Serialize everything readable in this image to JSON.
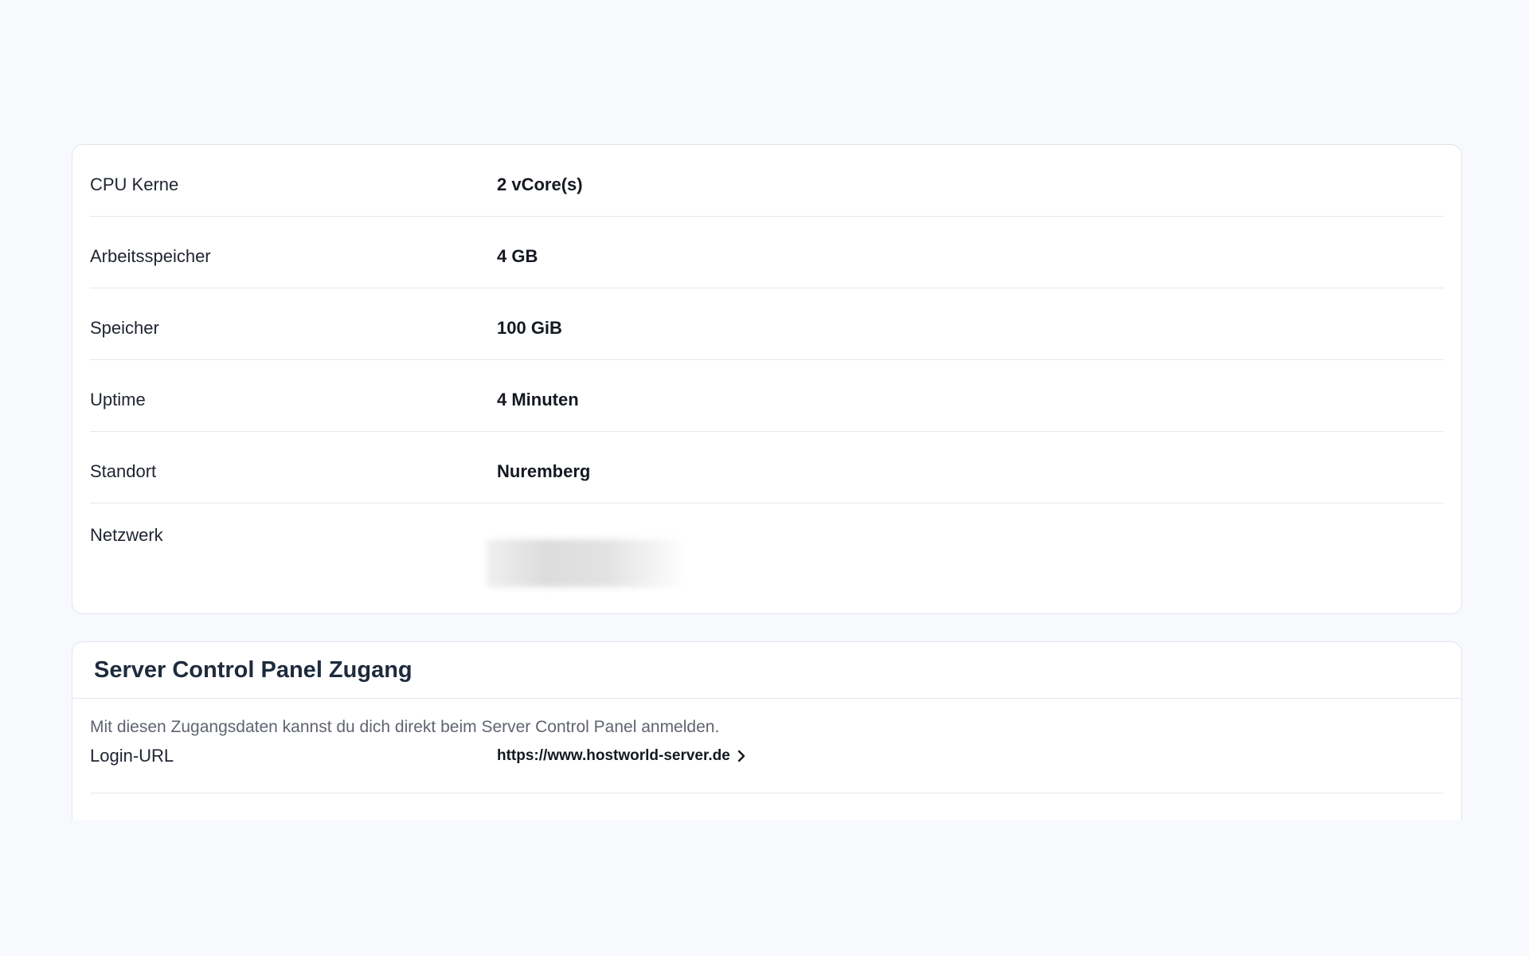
{
  "specs": {
    "rows": [
      {
        "label": "CPU Kerne",
        "value": "2 vCore(s)"
      },
      {
        "label": "Arbeitsspeicher",
        "value": "4 GB"
      },
      {
        "label": "Speicher",
        "value": "100 GiB"
      },
      {
        "label": "Uptime",
        "value": "4 Minuten"
      },
      {
        "label": "Standort",
        "value": "Nuremberg"
      },
      {
        "label": "Netzwerk",
        "value": ""
      }
    ]
  },
  "access": {
    "title": "Server Control Panel Zugang",
    "description": "Mit diesen Zugangsdaten kannst du dich direkt beim Server Control Panel anmelden.",
    "login_label": "Login-URL",
    "login_url": "https://www.hostworld-server.de",
    "link_icon": "chevron-right-icon"
  },
  "colors": {
    "background": "#f8f9fc",
    "card": "#ffffff",
    "border": "#e2e5ee",
    "title": "#1e2b3c"
  }
}
